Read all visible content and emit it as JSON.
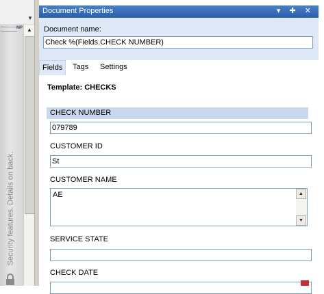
{
  "left_pane": {
    "header_mark": "MP",
    "security_text": "Security features. Details on back.",
    "icons": {
      "lock": "lock-icon",
      "dropdown": "chevron-down-icon",
      "scroll_up": "chevron-up-icon"
    }
  },
  "panel": {
    "title": "Document Properties",
    "title_icons": "▾ ✚ ✕",
    "document_name_label": "Document name:",
    "document_name_value": "Check %(Fields.CHECK NUMBER)"
  },
  "tabs": [
    {
      "label": "Fields",
      "active": true
    },
    {
      "label": "Tags",
      "active": false
    },
    {
      "label": "Settings",
      "active": false
    }
  ],
  "fields_panel": {
    "template_label": "Template: CHECKS",
    "fields": [
      {
        "label": "CHECK NUMBER",
        "value": "079789",
        "highlighted": true
      },
      {
        "label": "CUSTOMER ID",
        "value": "St",
        "highlighted": false
      },
      {
        "label": "CUSTOMER NAME",
        "value": "AE",
        "highlighted": false,
        "multiline": true
      },
      {
        "label": "SERVICE STATE",
        "value": "",
        "highlighted": false
      },
      {
        "label": "CHECK DATE",
        "value": "",
        "highlighted": false
      }
    ]
  },
  "colors": {
    "title_bar": "#2a5fa8",
    "section_background": "#dfe8f6",
    "field_highlight": "#c9d8ef",
    "error_marker": "#c0303a"
  }
}
